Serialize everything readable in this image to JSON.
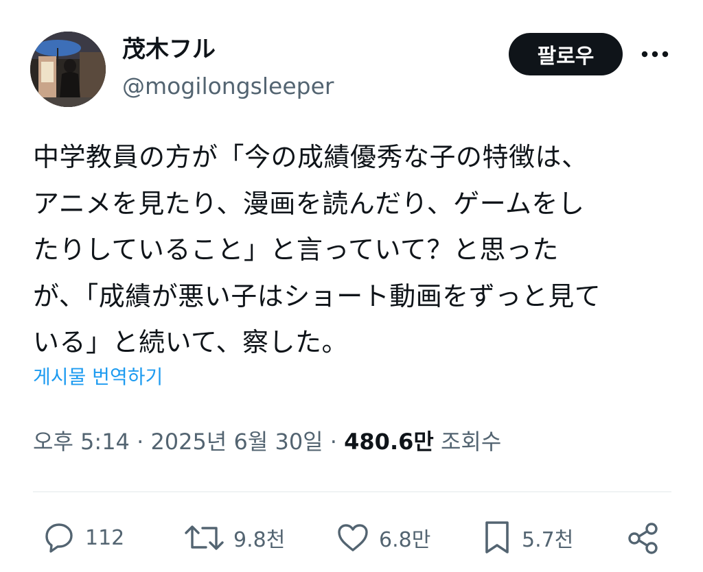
{
  "user": {
    "display_name": "茂木フル",
    "handle": "@mogilongsleeper"
  },
  "follow_label": "팔로우",
  "post": {
    "lines": [
      "中学教員の方が「今の成績優秀な子の特徴は、",
      "アニメを見たり、漫画を読んだり、ゲームをし",
      "たりしていること」と言っていて？と思った",
      "が、「成績が悪い子はショート動画をずっと見て",
      "いる」と続いて、察した。"
    ],
    "translate_label": "게시물 번역하기"
  },
  "meta": {
    "time": "오후 5:14",
    "separator": "·",
    "date": "2025년 6월 30일",
    "views_count": "480.6만",
    "views_label": "조회수"
  },
  "actions": {
    "replies": "112",
    "reposts": "9.8천",
    "likes": "6.8만",
    "bookmarks": "5.7천"
  },
  "icons": {
    "avatar": "avatar-photo",
    "more": "more-horizontal-icon",
    "reply": "reply-bubble-icon",
    "repost": "repost-arrows-icon",
    "like": "heart-icon",
    "bookmark": "bookmark-icon",
    "share": "share-icon"
  },
  "colors": {
    "text": "#0f1419",
    "secondary": "#536471",
    "link": "#1d9bf0",
    "button_bg": "#0f1419",
    "button_text": "#ffffff"
  }
}
